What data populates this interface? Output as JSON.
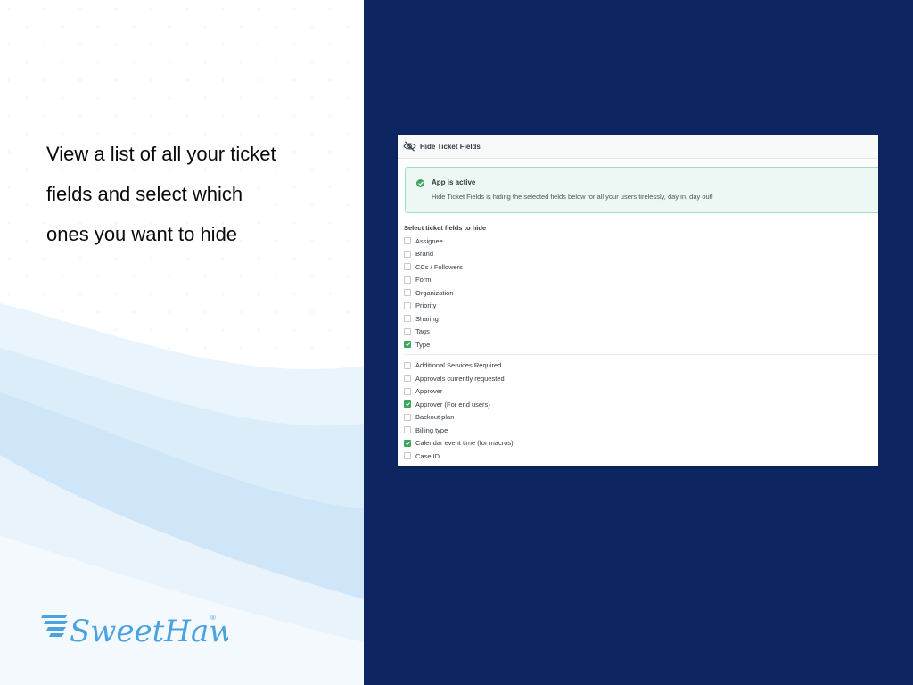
{
  "left": {
    "headline_lines": [
      "View a list of all your ticket",
      "fields and select which",
      "ones you want to hide"
    ],
    "logo_text": "SweetHawk",
    "logo_mark": "®"
  },
  "colors": {
    "navy": "#0d2560",
    "success": "#3fa45d",
    "logo_blue": "#4aa3df"
  },
  "app": {
    "title": "Hide Ticket Fields",
    "title_icon": "eye-slash-icon",
    "notice": {
      "title": "App is active",
      "text": "Hide Ticket Fields is hiding the selected fields below for all your users tirelessly, day in, day out!",
      "icon": "check-circle-icon"
    },
    "section_title": "Select ticket fields to hide",
    "system_fields": [
      {
        "label": "Assignee",
        "checked": false
      },
      {
        "label": "Brand",
        "checked": false
      },
      {
        "label": "CCs / Followers",
        "checked": false
      },
      {
        "label": "Form",
        "checked": false
      },
      {
        "label": "Organization",
        "checked": false
      },
      {
        "label": "Priority",
        "checked": false
      },
      {
        "label": "Sharing",
        "checked": false
      },
      {
        "label": "Tags",
        "checked": false
      },
      {
        "label": "Type",
        "checked": true
      }
    ],
    "custom_fields": [
      {
        "label": "Additional Services Required",
        "checked": false
      },
      {
        "label": "Approvals currently requested",
        "checked": false
      },
      {
        "label": "Approver",
        "checked": false
      },
      {
        "label": "Approver (For end users)",
        "checked": true
      },
      {
        "label": "Backout plan",
        "checked": false
      },
      {
        "label": "Billing type",
        "checked": false
      },
      {
        "label": "Calendar event time (for macros)",
        "checked": true
      },
      {
        "label": "Case ID",
        "checked": false
      }
    ]
  }
}
